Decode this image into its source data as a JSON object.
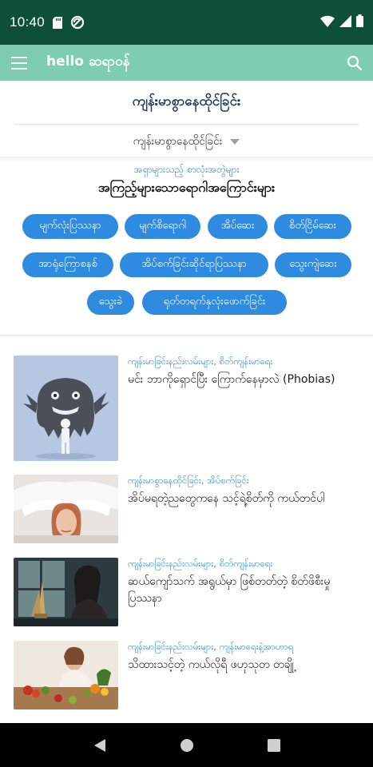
{
  "status_bar": {
    "time": "10:40"
  },
  "app_bar": {
    "logo_text": "hello ဆရာဝန်"
  },
  "section": {
    "title": "ကျန်းမာစွာနေထိုင်ခြင်း",
    "dropdown_value": "ကျန်းမာစွာနေထိုင်ခြင်း"
  },
  "topics": {
    "subtitle": "အရှာများသည့် စာလုံးအတွဲများ",
    "heading": "အကြည့်များသောရောဂါအကြောင်းများ",
    "pills": [
      "မျက်လုံးပြဿနာ",
      "မျက်စိရောဂါ",
      "အိပ်ဆေး",
      "စိတ်ငြိမ်ဆေး",
      "အာရုံကြောစနစ်",
      "အိပ်စက်ခြင်းဆိုင်ရာပြဿနာ",
      "သွေးကျဲဆေး",
      "သွေးခဲ",
      "ရုတ်တရက်နှလုံးဖောက်ခြင်း"
    ]
  },
  "articles": [
    {
      "category": "ကျန်းမာခြင်းနည်းလမ်းများ, စိတ်ကျန်းမာရေး",
      "title": "မင်း ဘာကိုရှောင်ပြီး ကြောက်နေမှာလဲ (Phobias)",
      "image": "phobia-monster-illustration"
    },
    {
      "category": "ကျန်းမာစွာနေထိုင်ခြင်း, အိပ်စက်ခြင်း",
      "title": "အိပ်မရတဲ့ညတွေကနေ သင့်ရဲ့စိတ်ကို ကယ်တင်ပါ",
      "image": "woman-with-pillow-photo"
    },
    {
      "category": "ကျန်းမာခြင်းနည်းလမ်းများ, စိတ်ကျန်းမာရေး",
      "title": "ဆယ်ကျော်သက် အရွယ်မှာ ဖြစ်တတ်တဲ့ စိတ်ဖိစီးမှု ပြဿနာ",
      "image": "sad-teen-window-photo"
    },
    {
      "category": "ကျန်းမာခြင်းနည်းလမ်းများ, ကျန်းမာရေးနဲ့အာဟာရ",
      "title": "သိထားသင့်တဲ့ ကယ်လိုရီ ဖဟုသုတ တချို့",
      "image": "woman-with-vegetables-photo"
    }
  ],
  "colors": {
    "status_bar": "#0e4f3a",
    "app_bar": "#7ecdb0",
    "accent_blue": "#2f8be0",
    "title_navy": "#1f3b5b"
  },
  "icons": [
    "sd-card-icon",
    "sync-icon",
    "wifi-icon",
    "signal-icon",
    "battery-icon",
    "menu-icon",
    "search-icon",
    "back-icon",
    "home-icon",
    "recents-icon",
    "dropdown-caret-icon"
  ]
}
